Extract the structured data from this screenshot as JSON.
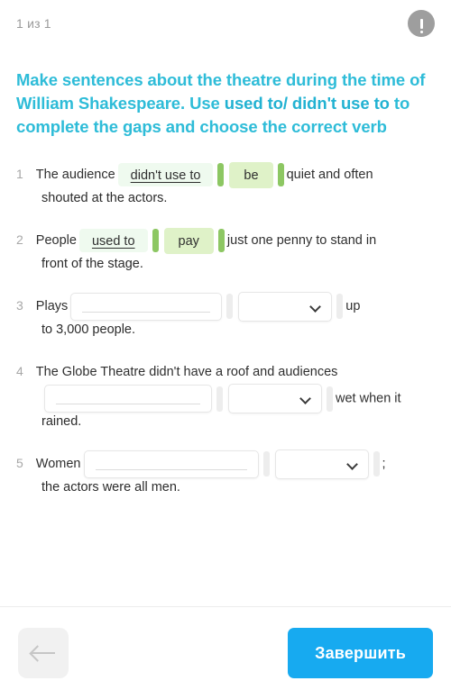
{
  "header": {
    "counter": "1 из 1",
    "warning_icon": "exclamation-circle-icon"
  },
  "title": {
    "part1": "Make sentences about the theatre during the time of William Shakespeare. Use ",
    "emphasis": "used to/ didn't use to",
    "part2": " to complete the gaps and choose the correct verb"
  },
  "questions": [
    {
      "number": "1",
      "before": "The audience",
      "blank_value": "didn't use to",
      "select_value": "be",
      "after": "quiet and often",
      "line2": "shouted at the actors.",
      "state": "filled"
    },
    {
      "number": "2",
      "before": "People",
      "blank_value": "used to",
      "select_value": "pay",
      "after": "just one penny to stand in",
      "line2": "front of the stage.",
      "state": "filled"
    },
    {
      "number": "3",
      "before": "Plays",
      "blank_value": "",
      "select_value": "",
      "after": "up",
      "line2": "to 3,000 people.",
      "state": "empty"
    },
    {
      "number": "4",
      "before": "The Globe Theatre didn't have a roof and audiences",
      "blank_value": "",
      "select_value": "",
      "after": "wet when it",
      "line2": "rained.",
      "state": "empty"
    },
    {
      "number": "5",
      "before": "Women",
      "blank_value": "",
      "select_value": "",
      "after": ";",
      "line2": "the actors were all men.",
      "state": "empty"
    }
  ],
  "footer": {
    "back_icon": "arrow-left-icon",
    "finish_label": "Завершить"
  },
  "colors": {
    "title": "#2ebcd8",
    "accent_blue": "#17aaf0",
    "answer_bar_green": "#8dc763",
    "answer_select_bg": "#dff2c8",
    "answer_blank_bg": "#effaef",
    "muted_grey": "#9a9a9a"
  }
}
